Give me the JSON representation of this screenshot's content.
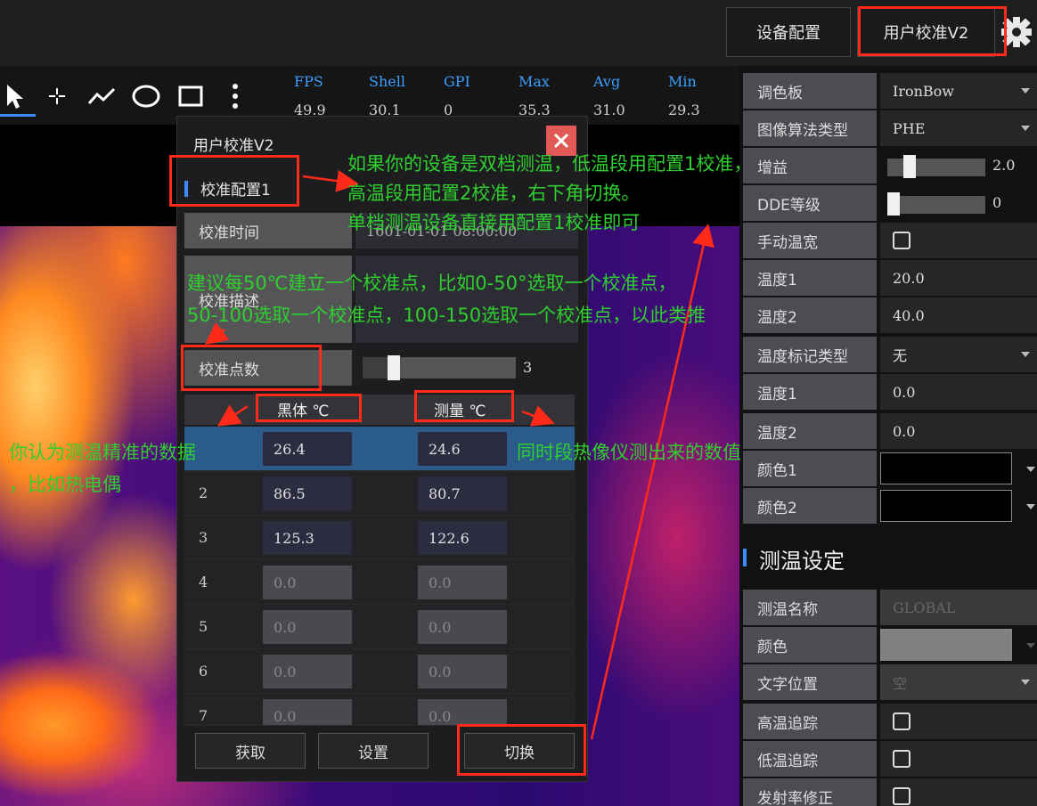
{
  "topbar": {
    "device_config": "设备配置",
    "user_calib": "用户校准V2"
  },
  "stats": [
    {
      "name": "FPS",
      "value": "49.9"
    },
    {
      "name": "Shell",
      "value": "30.1"
    },
    {
      "name": "GPI",
      "value": "0"
    },
    {
      "name": "Max",
      "value": "35.3"
    },
    {
      "name": "Avg",
      "value": "31.0"
    },
    {
      "name": "Min",
      "value": "29.3"
    }
  ],
  "dialog": {
    "title": "用户校准V2",
    "config_label": "校准配置1",
    "time_label": "校准时间",
    "time_value": "1601-01-01 08:00:00",
    "desc_label": "校准描述",
    "points_label": "校准点数",
    "points_value": "3",
    "col_blackbody": "黑体 ℃",
    "col_measured": "测量 ℃",
    "rows": [
      {
        "n": "",
        "bb": "26.4",
        "m": "24.6"
      },
      {
        "n": "2",
        "bb": "86.5",
        "m": "80.7"
      },
      {
        "n": "3",
        "bb": "125.3",
        "m": "122.6"
      },
      {
        "n": "4",
        "bb": "0.0",
        "m": "0.0"
      },
      {
        "n": "5",
        "bb": "0.0",
        "m": "0.0"
      },
      {
        "n": "6",
        "bb": "0.0",
        "m": "0.0"
      },
      {
        "n": "7",
        "bb": "0.0",
        "m": "0.0"
      }
    ],
    "btn_get": "获取",
    "btn_set": "设置",
    "btn_switch": "切换"
  },
  "panel": {
    "palette_label": "调色板",
    "palette_value": "IronBow",
    "algo_label": "图像算法类型",
    "algo_value": "PHE",
    "gain_label": "增益",
    "gain_value": "2.0",
    "dde_label": "DDE等级",
    "dde_value": "0",
    "manual_label": "手动温宽",
    "temp1_label": "温度1",
    "temp1_value": "20.0",
    "temp2_label": "温度2",
    "temp2_value": "40.0",
    "marker_label": "温度标记类型",
    "marker_value": "无",
    "temp1b_label": "温度1",
    "temp1b_value": "0.0",
    "temp2b_label": "温度2",
    "temp2b_value": "0.0",
    "color1_label": "颜色1",
    "color2_label": "颜色2",
    "section_title": "测温设定",
    "name_label": "测温名称",
    "name_placeholder": "GLOBAL",
    "color_label": "颜色",
    "textpos_label": "文字位置",
    "textpos_value": "空",
    "high_label": "高温追踪",
    "low_label": "低温追踪",
    "emis_label": "发射率修正",
    "colors": {
      "color1": "#000000",
      "color2": "#000000",
      "color": "#808080"
    }
  },
  "notes": {
    "dual": [
      "如果你的设备是双档测温，低温段用配置1校准，",
      "高温段用配置2校准，右下角切换。",
      "单档测温设备直接用配置1校准即可"
    ],
    "suggest": [
      "建议每50℃建立一个校准点，比如0-50°选取一个校准点，",
      "50-100选取一个校准点，100-150选取一个校准点，以此类推"
    ],
    "left": [
      "你认为测温精准的数据",
      "，比如热电偶"
    ],
    "right": "同时段热像仪测出来的数值"
  }
}
